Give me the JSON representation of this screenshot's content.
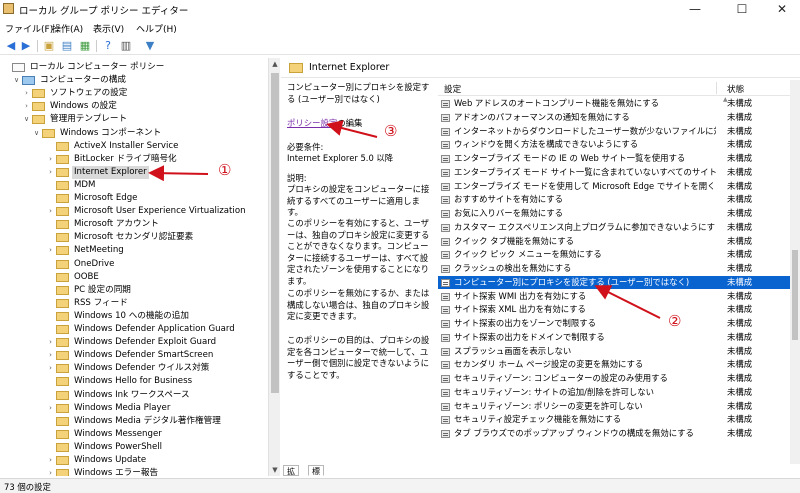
{
  "window": {
    "title": "ローカル グループ ポリシー エディター",
    "minimize": "—",
    "maximize": "☐",
    "close": "✕"
  },
  "menu": [
    "ファイル(F)",
    "操作(A)",
    "表示(V)",
    "ヘルプ(H)"
  ],
  "toolbar": [
    "back-icon",
    "forward-icon",
    "up-folder-icon",
    "show-hide-tree-icon",
    "export-list-icon",
    "help-icon",
    "properties-icon",
    "filter-icon"
  ],
  "tree": [
    {
      "label": "ローカル コンピューター ポリシー",
      "depth": 0,
      "exp": "",
      "icon": "doc"
    },
    {
      "label": "コンピューターの構成",
      "depth": 1,
      "exp": "∨",
      "icon": "comp"
    },
    {
      "label": "ソフトウェアの設定",
      "depth": 2,
      "exp": "›",
      "icon": "folder"
    },
    {
      "label": "Windows の設定",
      "depth": 2,
      "exp": "›",
      "icon": "folder"
    },
    {
      "label": "管理用テンプレート",
      "depth": 2,
      "exp": "∨",
      "icon": "folder"
    },
    {
      "label": "Windows コンポーネント",
      "depth": 3,
      "exp": "∨",
      "icon": "folder"
    },
    {
      "label": "ActiveX Installer Service",
      "depth": 4,
      "exp": "",
      "icon": "folder"
    },
    {
      "label": "BitLocker ドライブ暗号化",
      "depth": 4,
      "exp": "›",
      "icon": "folder"
    },
    {
      "label": "Internet Explorer",
      "depth": 4,
      "exp": "›",
      "icon": "folder",
      "selected": true
    },
    {
      "label": "MDM",
      "depth": 4,
      "exp": "",
      "icon": "folder"
    },
    {
      "label": "Microsoft Edge",
      "depth": 4,
      "exp": "",
      "icon": "folder"
    },
    {
      "label": "Microsoft User Experience Virtualization",
      "depth": 4,
      "exp": "›",
      "icon": "folder"
    },
    {
      "label": "Microsoft アカウント",
      "depth": 4,
      "exp": "",
      "icon": "folder"
    },
    {
      "label": "Microsoft セカンダリ認証要素",
      "depth": 4,
      "exp": "",
      "icon": "folder"
    },
    {
      "label": "NetMeeting",
      "depth": 4,
      "exp": "›",
      "icon": "folder"
    },
    {
      "label": "OneDrive",
      "depth": 4,
      "exp": "",
      "icon": "folder"
    },
    {
      "label": "OOBE",
      "depth": 4,
      "exp": "",
      "icon": "folder"
    },
    {
      "label": "PC 設定の同期",
      "depth": 4,
      "exp": "",
      "icon": "folder"
    },
    {
      "label": "RSS フィード",
      "depth": 4,
      "exp": "",
      "icon": "folder"
    },
    {
      "label": "Windows 10 への機能の追加",
      "depth": 4,
      "exp": "",
      "icon": "folder"
    },
    {
      "label": "Windows Defender Application Guard",
      "depth": 4,
      "exp": "",
      "icon": "folder"
    },
    {
      "label": "Windows Defender Exploit Guard",
      "depth": 4,
      "exp": "›",
      "icon": "folder"
    },
    {
      "label": "Windows Defender SmartScreen",
      "depth": 4,
      "exp": "›",
      "icon": "folder"
    },
    {
      "label": "Windows Defender ウイルス対策",
      "depth": 4,
      "exp": "›",
      "icon": "folder"
    },
    {
      "label": "Windows Hello for Business",
      "depth": 4,
      "exp": "",
      "icon": "folder"
    },
    {
      "label": "Windows Ink ワークスペース",
      "depth": 4,
      "exp": "",
      "icon": "folder"
    },
    {
      "label": "Windows Media Player",
      "depth": 4,
      "exp": "›",
      "icon": "folder"
    },
    {
      "label": "Windows Media デジタル著作権管理",
      "depth": 4,
      "exp": "",
      "icon": "folder"
    },
    {
      "label": "Windows Messenger",
      "depth": 4,
      "exp": "",
      "icon": "folder"
    },
    {
      "label": "Windows PowerShell",
      "depth": 4,
      "exp": "",
      "icon": "folder"
    },
    {
      "label": "Windows Update",
      "depth": 4,
      "exp": "›",
      "icon": "folder"
    },
    {
      "label": "Windows エラー報告",
      "depth": 4,
      "exp": "›",
      "icon": "folder"
    }
  ],
  "right": {
    "header": "Internet Explorer",
    "desc": {
      "title": "コンピューター別にプロキシを設定する (ユーザー別ではなく)",
      "edit_link": "ポリシー設定",
      "edit_suffix": "の編集",
      "req_label": "必要条件:",
      "req_value": "Internet Explorer 5.0 以降",
      "exp_label": "説明:",
      "p1": "プロキシの設定をコンピューターに接続するすべてのユーザーに適用します。",
      "p2": "このポリシーを有効にすると、ユーザーは、独自のプロキシ設定に変更することができなくなります。コンピューターに接続するユーザーは、すべて設定されたゾーンを使用することになります。",
      "p3": "このポリシーを無効にするか、または構成しない場合は、独自のプロキシ設定に変更できます。",
      "p4": "このポリシーの目的は、プロキシの設定を各コンピューターで統一して、ユーザー側で個別に設定できないようにすることです。"
    },
    "columns": {
      "setting": "設定",
      "state": "状態"
    },
    "rows": [
      {
        "name": "Web アドレスのオートコンプリート機能を無効にする",
        "state": "未構成"
      },
      {
        "name": "アドオンのパフォーマンスの通知を無効にする",
        "state": "未構成"
      },
      {
        "name": "インターネットからダウンロードしたユーザー数が少ないファイルに対する…",
        "state": "未構成"
      },
      {
        "name": "ウィンドウを開く方法を構成できないようにする",
        "state": "未構成"
      },
      {
        "name": "エンタープライズ モードの IE の Web サイト一覧を使用する",
        "state": "未構成"
      },
      {
        "name": "エンタープライズ モード サイト一覧に含まれていないすべてのサイトを…",
        "state": "未構成"
      },
      {
        "name": "エンタープライズ モードを使用して Microsoft Edge でサイトを開くとき…",
        "state": "未構成"
      },
      {
        "name": "おすすめサイトを有効にする",
        "state": "未構成"
      },
      {
        "name": "お気に入りバーを無効にする",
        "state": "未構成"
      },
      {
        "name": "カスタマー エクスペリエンス向上プログラムに参加できないようにする",
        "state": "未構成"
      },
      {
        "name": "クイック タブ機能を無効にする",
        "state": "未構成"
      },
      {
        "name": "クイック ピック メニューを無効にする",
        "state": "未構成"
      },
      {
        "name": "クラッシュの検出を無効にする",
        "state": "未構成"
      },
      {
        "name": "コンピューター別にプロキシを設定する (ユーザー別ではなく)",
        "state": "未構成",
        "selected": true
      },
      {
        "name": "サイト探索 WMI 出力を有効にする",
        "state": "未構成"
      },
      {
        "name": "サイト探索 XML 出力を有効にする",
        "state": "未構成"
      },
      {
        "name": "サイト探索の出力をゾーンで制限する",
        "state": "未構成"
      },
      {
        "name": "サイト探索の出力をドメインで制限する",
        "state": "未構成"
      },
      {
        "name": "スプラッシュ画面を表示しない",
        "state": "未構成"
      },
      {
        "name": "セカンダリ ホーム ページ設定の変更を無効にする",
        "state": "未構成"
      },
      {
        "name": "セキュリティゾーン: コンピューターの設定のみ使用する",
        "state": "未構成"
      },
      {
        "name": "セキュリティゾーン: サイトの追加/削除を許可しない",
        "state": "未構成"
      },
      {
        "name": "セキュリティゾーン: ポリシーの変更を許可しない",
        "state": "未構成"
      },
      {
        "name": "セキュリティ設定チェック機能を無効にする",
        "state": "未構成"
      },
      {
        "name": "タブ ブラウズでのポップアップ ウィンドウの構成を無効にする",
        "state": "未構成"
      }
    ],
    "tabs": [
      "拡張",
      "標準"
    ]
  },
  "status": "73 個の設定",
  "annotations": {
    "one": "①",
    "two": "②",
    "three": "③",
    "color": "#d0101a"
  }
}
